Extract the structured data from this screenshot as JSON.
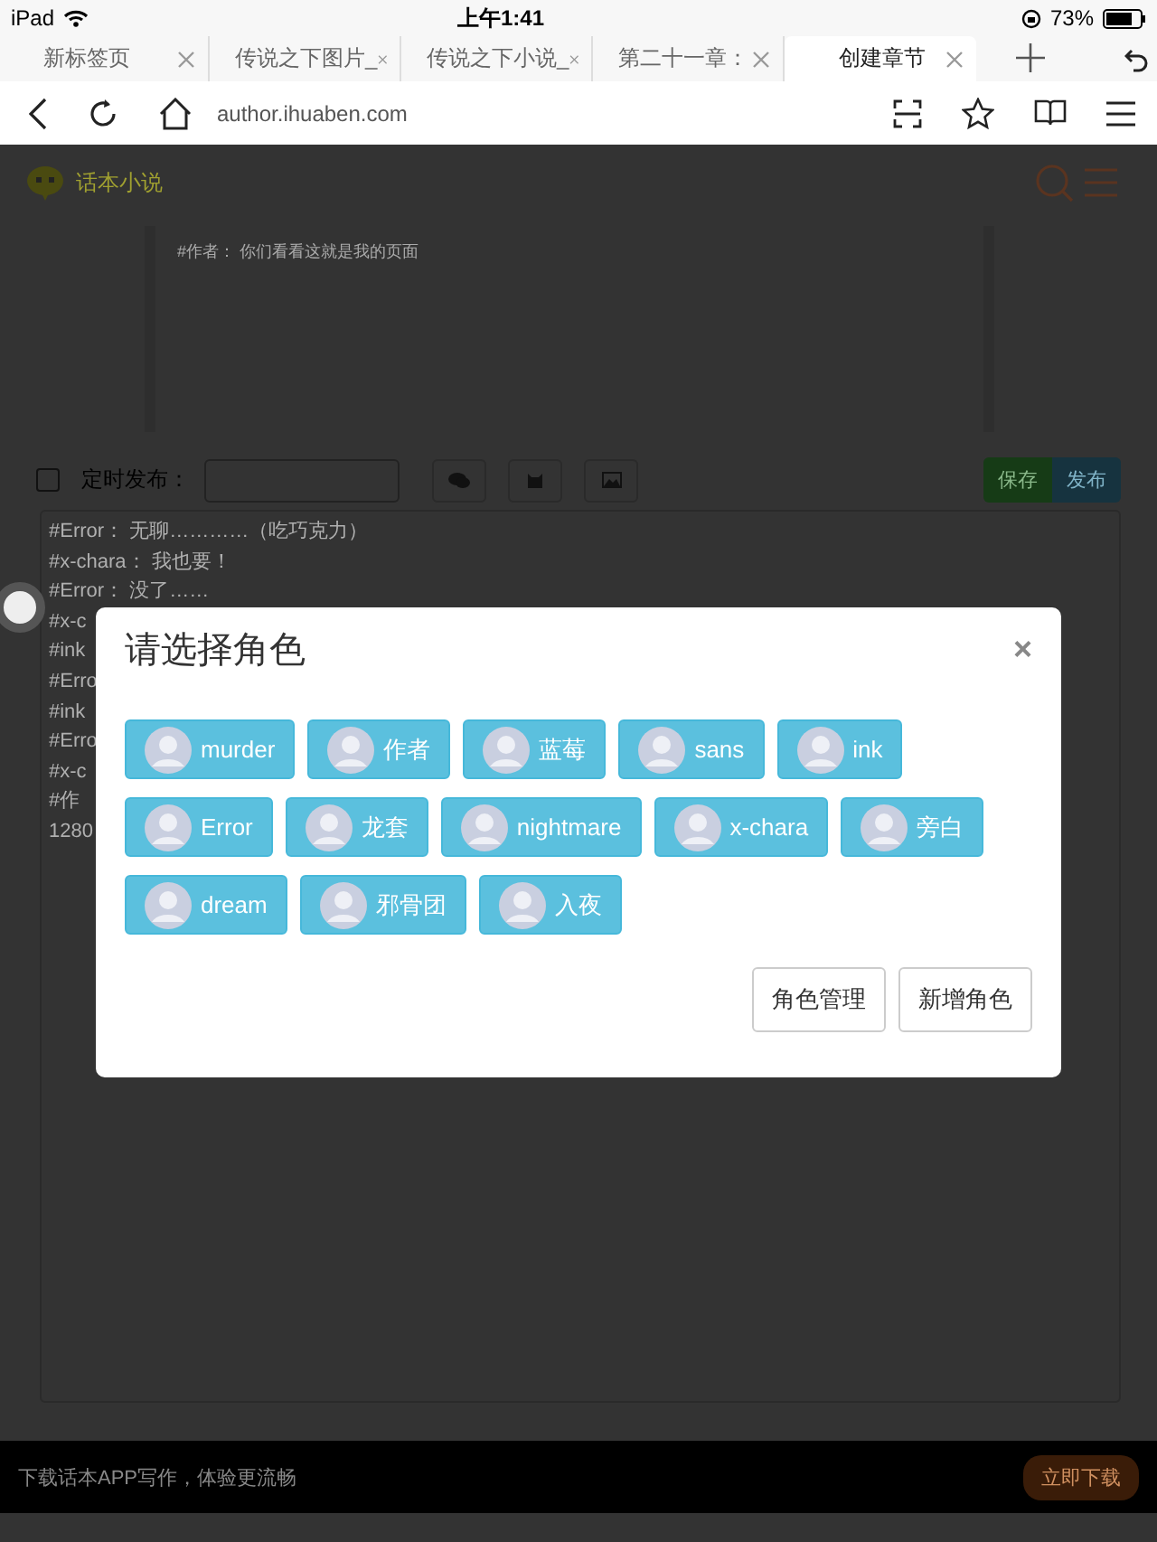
{
  "status_bar": {
    "device": "iPad",
    "time": "上午1:41",
    "battery": "73%"
  },
  "tabs": [
    {
      "label": "新标签页",
      "selected": false
    },
    {
      "label": "传说之下图片_",
      "selected": false
    },
    {
      "label": "传说之下小说_",
      "selected": false
    },
    {
      "label": "第二十一章：",
      "selected": false
    },
    {
      "label": "创建章节",
      "selected": true
    }
  ],
  "address_bar": {
    "url": "author.ihuaben.com"
  },
  "site": {
    "logo_text": "话本小说"
  },
  "preview": {
    "text": "#作者： 你们看看这就是我的页面"
  },
  "toolbar": {
    "schedule_checked": false,
    "schedule_label": "定时发布：",
    "save": "保存",
    "publish": "发布"
  },
  "editor_lines": [
    "#Error： 无聊…………（吃巧克力）",
    "#x-chara： 我也要！",
    "#Error： 没了……",
    "#x-c",
    "#ink",
    "#Erro",
    "#ink",
    "#Erro",
    "#x-c",
    "#作",
    "1280"
  ],
  "dialog": {
    "title": "请选择角色",
    "close": "×",
    "roles": [
      "murder",
      "作者",
      "蓝莓",
      "sans",
      "ink",
      "Error",
      "龙套",
      "nightmare",
      "x-chara",
      "旁白",
      "dream",
      "邪骨团",
      "入夜"
    ],
    "buttons": [
      "角色管理",
      "新增角色"
    ]
  },
  "banner": {
    "text": "下载话本APP写作，体验更流畅",
    "button": "立即下载"
  }
}
